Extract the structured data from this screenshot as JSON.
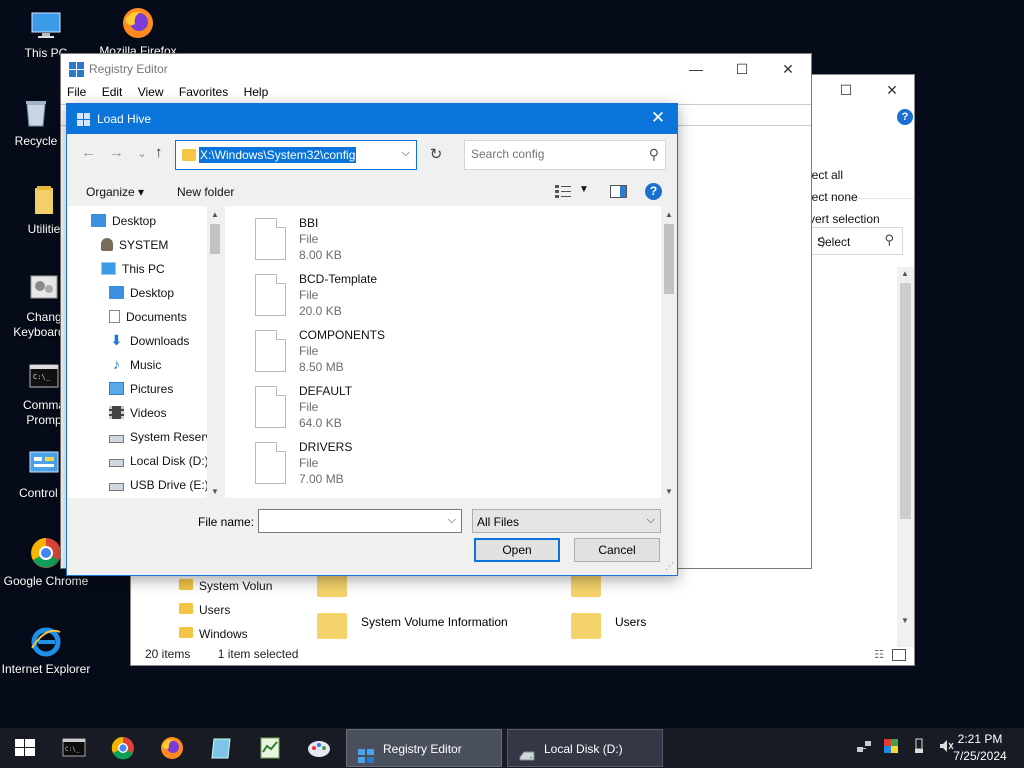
{
  "desktop": {
    "icons": [
      {
        "label": "This PC"
      },
      {
        "label": "Mozilla Firefox"
      },
      {
        "label": "Recycle"
      },
      {
        "label": "Utilitie"
      },
      {
        "label": "Chang",
        "label2": "Keyboard L"
      },
      {
        "label": "Comma",
        "label2": "Promp"
      },
      {
        "label": "Control P"
      },
      {
        "label": "Google Chrome"
      },
      {
        "label": "Internet Explorer"
      }
    ]
  },
  "explorer": {
    "ribbon": {
      "select_all": "lect all",
      "select_none": "lect none",
      "invert_selection": "vert selection",
      "select_group": "Select"
    },
    "search_text": ":)",
    "nav_items": [
      "System Volun",
      "Users",
      "Windows"
    ],
    "content_items": [
      "System Volume Information",
      "Users"
    ],
    "status": {
      "count": "20 items",
      "selected": "1 item selected"
    }
  },
  "regedit": {
    "title": "Registry Editor",
    "menu": [
      "File",
      "Edit",
      "View",
      "Favorites",
      "Help"
    ]
  },
  "dialog": {
    "title": "Load Hive",
    "close_glyph": "✕",
    "address": "X:\\Windows\\System32\\config",
    "search_placeholder": "Search config",
    "toolbar": {
      "organize": "Organize ▾",
      "new_folder": "New folder",
      "help": "?"
    },
    "tree": [
      {
        "label": "Desktop",
        "indent": 0
      },
      {
        "label": "SYSTEM",
        "indent": 1
      },
      {
        "label": "This PC",
        "indent": 1
      },
      {
        "label": "Desktop",
        "indent": 2
      },
      {
        "label": "Documents",
        "indent": 2
      },
      {
        "label": "Downloads",
        "indent": 2
      },
      {
        "label": "Music",
        "indent": 2
      },
      {
        "label": "Pictures",
        "indent": 2
      },
      {
        "label": "Videos",
        "indent": 2
      },
      {
        "label": "System Reserve",
        "indent": 2
      },
      {
        "label": "Local Disk (D:)",
        "indent": 2
      },
      {
        "label": "USB Drive (E:)",
        "indent": 2
      }
    ],
    "files": [
      {
        "name": "BBI",
        "type": "File",
        "size": "8.00 KB"
      },
      {
        "name": "BCD-Template",
        "type": "File",
        "size": "20.0 KB"
      },
      {
        "name": "COMPONENTS",
        "type": "File",
        "size": "8.50 MB"
      },
      {
        "name": "DEFAULT",
        "type": "File",
        "size": "64.0 KB"
      },
      {
        "name": "DRIVERS",
        "type": "File",
        "size": "7.00 MB"
      }
    ],
    "filename_label": "File name:",
    "filename_value": "",
    "filetype_value": "All Files",
    "open_label": "Open",
    "cancel_label": "Cancel"
  },
  "taskbar": {
    "tasks": [
      {
        "label": "Registry Editor"
      },
      {
        "label": "Local Disk (D:)"
      }
    ],
    "clock": {
      "time": "2:21 PM",
      "date": "7/25/2024"
    }
  },
  "colors": {
    "accent": "#0a74da",
    "taskbar": "#181b24",
    "desktop": "#060b1a"
  }
}
